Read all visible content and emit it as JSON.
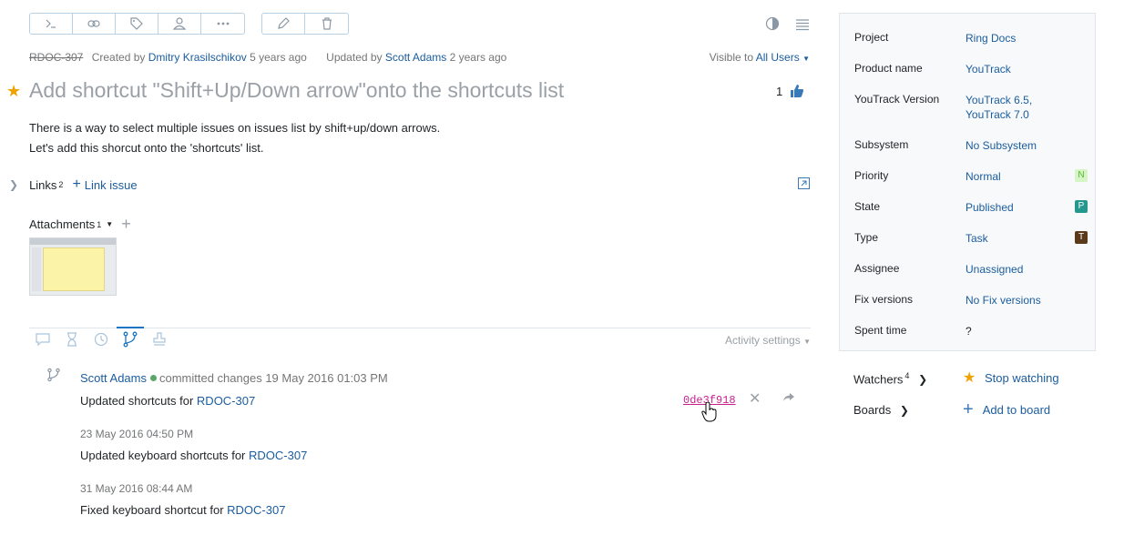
{
  "toolbar": {
    "group1": [
      {
        "icon": "command-icon",
        "glyph": ">_"
      },
      {
        "icon": "link-icon"
      },
      {
        "icon": "tag-icon"
      },
      {
        "icon": "user-icon"
      },
      {
        "icon": "more-icon"
      }
    ],
    "group2": [
      {
        "icon": "edit-icon"
      },
      {
        "icon": "delete-icon"
      }
    ]
  },
  "issue": {
    "id": "RDOC-307",
    "created_prefix": "Created by",
    "created_by": "Dmitry Krasilschikov",
    "created_ago": "5 years ago",
    "updated_prefix": "Updated by",
    "updated_by": "Scott Adams",
    "updated_ago": "2 years ago",
    "visible_prefix": "Visible to",
    "visible_to": "All Users",
    "summary": "Add shortcut \"Shift+Up/Down arrow\"onto the shortcuts list",
    "votes": "1",
    "description": [
      "There is a way to select multiple issues on issues list by shift+up/down arrows.",
      "Let's add this shorcut onto the 'shortcuts' list."
    ],
    "links_label": "Links",
    "links_count": "2",
    "link_issue": "Link issue",
    "attachments_label": "Attachments",
    "attachments_count": "1"
  },
  "activity": {
    "settings": "Activity settings",
    "author": "Scott Adams",
    "action": "committed changes 19 May 2016 01:03 PM",
    "commits": [
      {
        "date": "",
        "text": "Updated shortcuts for",
        "ref": "RDOC-307",
        "hash": "0de3f918"
      },
      {
        "date": "23 May 2016 04:50 PM",
        "text": "Updated keyboard shortcuts for",
        "ref": "RDOC-307"
      },
      {
        "date": "31 May 2016 08:44 AM",
        "text": "Fixed keyboard shortcut for",
        "ref": "RDOC-307"
      }
    ]
  },
  "fields": [
    {
      "key": "Project",
      "value": "Ring Docs"
    },
    {
      "key": "Product name",
      "value": "YouTrack"
    },
    {
      "key": "YouTrack Version",
      "value": "YouTrack 6.5,",
      "value2": "YouTrack 7.0"
    },
    {
      "key": "Subsystem",
      "value": "No Subsystem"
    },
    {
      "key": "Priority",
      "value": "Normal",
      "badge": "N",
      "badge_bg": "#d6f5c4",
      "badge_fg": "#5bb33a"
    },
    {
      "key": "State",
      "value": "Published",
      "badge": "P",
      "badge_bg": "#25988e",
      "badge_fg": "#ffffff"
    },
    {
      "key": "Type",
      "value": "Task",
      "badge": "T",
      "badge_bg": "#5b3a1a",
      "badge_fg": "#ffffff"
    },
    {
      "key": "Assignee",
      "value": "Unassigned"
    },
    {
      "key": "Fix versions",
      "value": "No Fix versions"
    },
    {
      "key": "Spent time",
      "value": "?"
    }
  ],
  "watchers": {
    "label": "Watchers",
    "count": "4",
    "action": "Stop watching"
  },
  "boards": {
    "label": "Boards",
    "action": "Add to board"
  }
}
